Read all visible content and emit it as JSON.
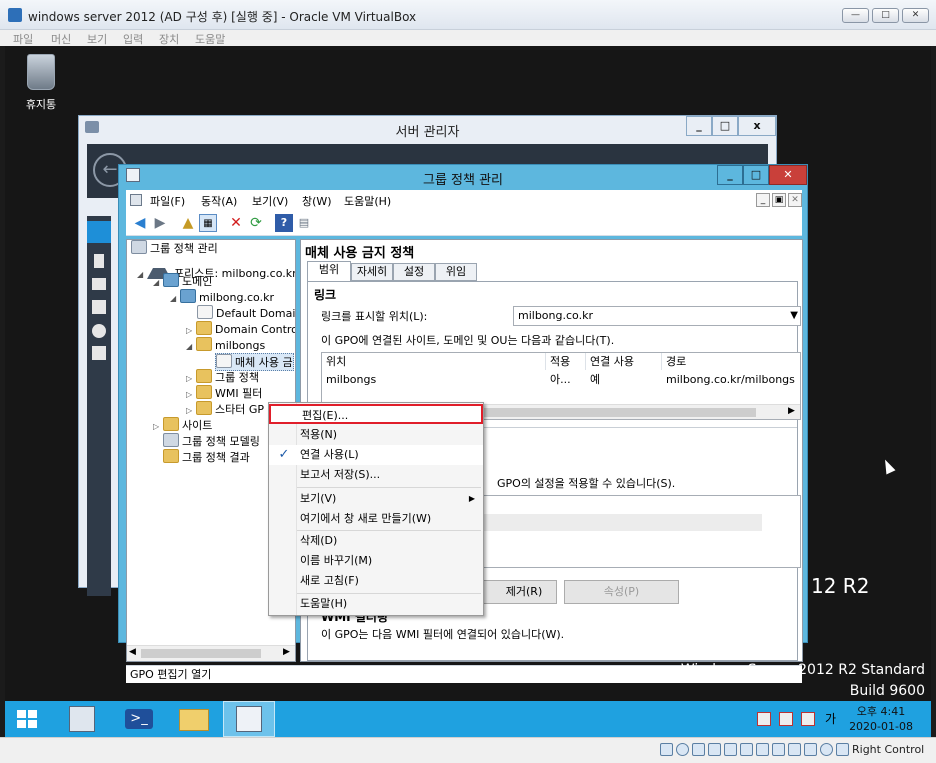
{
  "vbox": {
    "title": "windows server 2012 (AD 구성 후) [실행 중] - Oracle VM VirtualBox",
    "menu": [
      "파일",
      "머신",
      "보기",
      "입력",
      "장치",
      "도움말"
    ],
    "status_right": "Right Control"
  },
  "desktop": {
    "recycle_bin_label": "휴지통",
    "brand_suffix": "12 R2",
    "edition": "Windows Server 2012 R2 Standard",
    "build": "Build 9600"
  },
  "server_manager": {
    "title": "서버 관리자"
  },
  "gpm": {
    "title": "그룹 정책 관리",
    "menu": [
      "파일(F)",
      "동작(A)",
      "보기(V)",
      "창(W)",
      "도움말(H)"
    ],
    "status_text": "GPO 편집기 열기"
  },
  "tree": {
    "root": "그룹 정책 관리",
    "forest": "포리스트: milbong.co.kr",
    "domains": "도메인",
    "domain": "milbong.co.kr",
    "default_domain": "Default Domain",
    "domain_controllers": "Domain Contro",
    "ou": "milbongs",
    "selected_gpo": "매체 사용 금",
    "gp_objects": "그룹 정책",
    "wmi": "WMI 필터",
    "starter": "스타터 GP",
    "sites": "사이트",
    "modeling": "그룹 정책 모델링",
    "results": "그룹 정책 결과"
  },
  "details": {
    "gpo_title": "매체 사용 금지 정책",
    "tabs": [
      "범위",
      "자세히",
      "설정",
      "위임"
    ],
    "links_heading": "링크",
    "links_label": "링크를 표시할 위치(L):",
    "links_value": "milbong.co.kr",
    "links_desc": "이 GPO에 연결된 사이트, 도메인 및 OU는 다음과 같습니다(T).",
    "columns": [
      "위치",
      "적용",
      "연결 사용",
      "경로"
    ],
    "row": {
      "location": "milbongs",
      "enforced": "아...",
      "enabled": "예",
      "path": "milbong.co.kr/milbongs"
    },
    "security_desc": "GPO의 설정을 적용할 수 있습니다(S).",
    "btn_remove": "제거(R)",
    "btn_properties": "속성(P)",
    "wmi_heading": "WMI 필터링",
    "wmi_desc": "이 GPO는 다음 WMI 필터에 연결되어 있습니다(W)."
  },
  "context_menu": {
    "edit": "편집(E)...",
    "enforce": "적용(N)",
    "link_enabled": "연결 사용(L)",
    "save_report": "보고서 저장(S)...",
    "view": "보기(V)",
    "new_window": "여기에서 창 새로 만들기(W)",
    "delete": "삭제(D)",
    "rename": "이름 바꾸기(M)",
    "refresh": "새로 고침(F)",
    "help": "도움말(H)",
    "check_mark": "✓",
    "edit_highlight_color": "#e01e2a"
  },
  "taskbar": {
    "time": "오후 4:41",
    "date": "2020-01-08",
    "ime": "가",
    "color": "#1fa1e0"
  }
}
